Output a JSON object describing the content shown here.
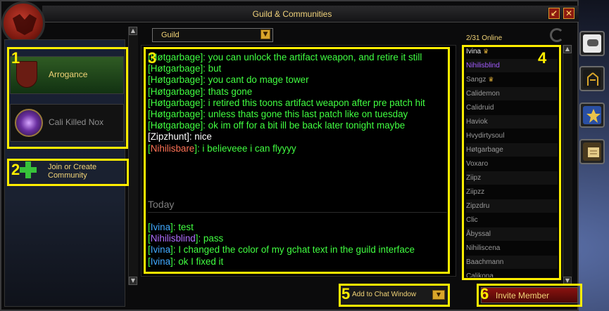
{
  "window": {
    "title": "Guild & Communities"
  },
  "communities": [
    {
      "name": "Arrogance",
      "selected": true
    },
    {
      "name": "Cali Killed Nox",
      "selected": false
    }
  ],
  "join_label": "Join or Create Community",
  "stream_dropdown": {
    "selected": "Guild"
  },
  "chat": {
    "earlier": [
      {
        "name": "Høtgarbage",
        "text": "you can unlock the artifact weapon, and retire it still"
      },
      {
        "name": "Høtgarbage",
        "text": "but"
      },
      {
        "name": "Høtgarbage",
        "text": "you cant do mage tower"
      },
      {
        "name": "Høtgarbage",
        "text": "thats gone"
      },
      {
        "name": "Høtgarbage",
        "text": "i retired this toons artifact weapon after pre patch hit"
      },
      {
        "name": "Høtgarbage",
        "text": "unless thats gone this last patch like on tuesday"
      },
      {
        "name": "Høtgarbage",
        "text": "ok im off for a bit ill be back later tonight maybe"
      },
      {
        "name": "Zipzhunt",
        "text": "nice"
      },
      {
        "name": "Nihilisbare",
        "text": "i believeee i can flyyyy"
      }
    ],
    "divider": "Today",
    "today": [
      {
        "name": "Ivina",
        "text": "test"
      },
      {
        "name": "Nihilisblind",
        "text": "pass"
      },
      {
        "name": "Ivina",
        "text": "I changed the color of my gchat text in the guild interface"
      },
      {
        "name": "Ivina",
        "text": "ok I fixed it"
      }
    ]
  },
  "roster": {
    "online_count": "2/31 Online",
    "members": [
      "Ivina",
      "Nihilisblind",
      "Sangz",
      "Calidemon",
      "Calidruid",
      "Haviok",
      "Hvydirtysoul",
      "Høtgarbage",
      "Voxaro",
      "Ziipz",
      "Ziipzz",
      "Zipzdru",
      "Clic",
      "Åbyssal",
      "Nihiliscena",
      "Baachmann",
      "Calikona"
    ]
  },
  "bottom": {
    "add_to_chat": "Add to Chat Window",
    "invite": "Invite Member"
  },
  "annotations": [
    "1",
    "2",
    "3",
    "4",
    "5",
    "6"
  ],
  "colors": {
    "gold_text": "#f2d477",
    "chat_green": "#41ff41",
    "annotation": "#ffee00",
    "invite_red": "#8a120f"
  }
}
